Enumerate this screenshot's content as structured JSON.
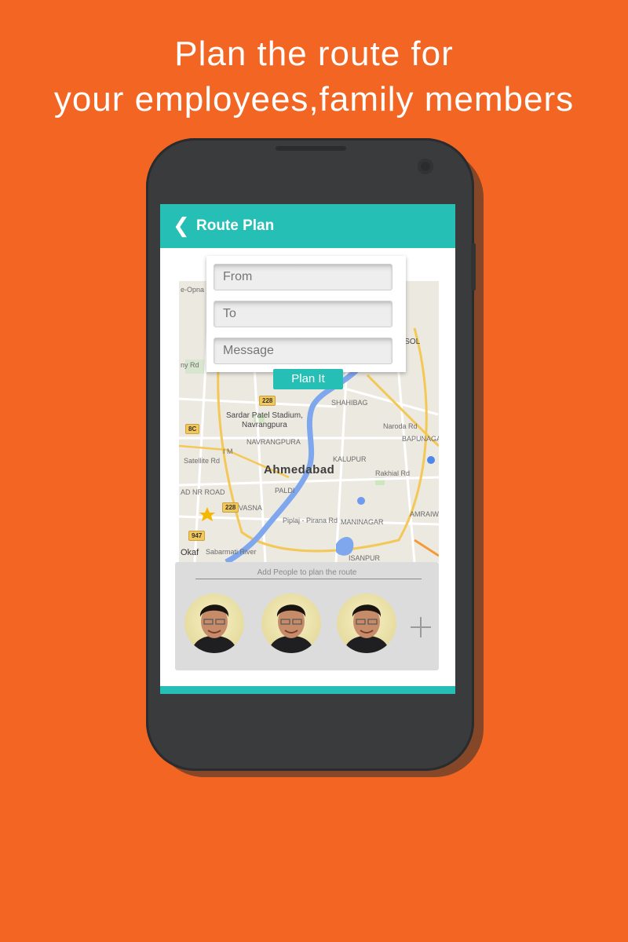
{
  "promo": {
    "line1": "Plan the route for",
    "line2": "your employees,family members"
  },
  "app": {
    "title": "Route Plan",
    "back_icon": "chevron-left-icon"
  },
  "form": {
    "from_placeholder": "From",
    "to_placeholder": "To",
    "message_placeholder": "Message",
    "plan_button": "Plan It"
  },
  "map": {
    "city": "Ahmedabad",
    "labels": {
      "stadium": "Sardar Patel Stadium,",
      "navrangpura1": "Navrangpura",
      "navrangpura2": "NAVRANGPURA",
      "shahibag": "SHAHIBAG",
      "naroda": "Naroda Rd",
      "bapunagar": "BAPUNAGAR",
      "kalupur": "KALUPUR",
      "rakhial": "Rakhial Rd",
      "satellite": "Satellite Rd",
      "paldi": "PALDI",
      "vasna": "VASNA",
      "maninagar": "MANINAGAR",
      "amraiwadi": "AMRAIWA",
      "isanpur": "ISANPUR",
      "pirana": "Piplaj - Pirana Rd",
      "sabarmati": "Sabarmati River",
      "nsol": "NSOL",
      "okaf": "Okaf",
      "myr": "ny Rd",
      "opna": "e-Opna",
      "im": "I M",
      "adnroad": "AD NR ROAD"
    },
    "shields": {
      "s1": "228",
      "s2": "8C",
      "s3": "228",
      "s4": "947"
    }
  },
  "people": {
    "hint": "Add People to plan the route",
    "avatars": [
      "avatar-1",
      "avatar-2",
      "avatar-3"
    ],
    "add_icon": "plus-icon"
  },
  "colors": {
    "background": "#F26522",
    "accent": "#26BFB5"
  }
}
